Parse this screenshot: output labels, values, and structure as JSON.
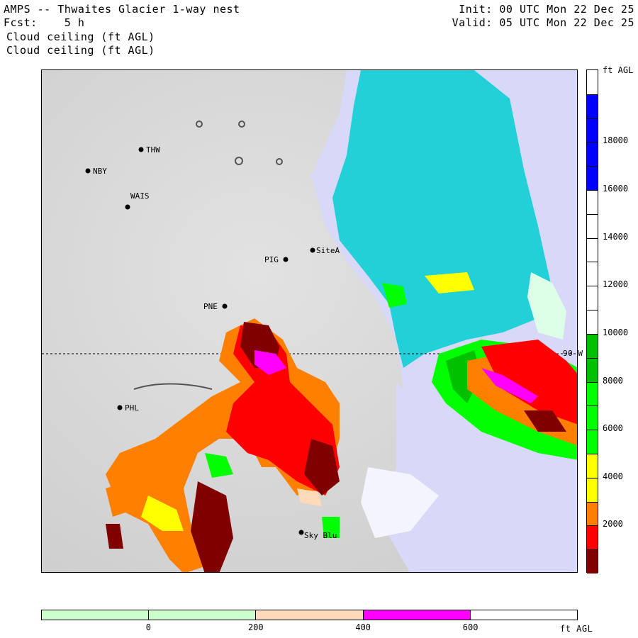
{
  "header": {
    "title": "AMPS -- Thwaites Glacier 1-way nest",
    "forecast": "Fcst:    5 h",
    "init": "Init: 00 UTC Mon 22 Dec 25",
    "valid": "Valid: 05 UTC Mon 22 Dec 25",
    "field_line1": "Cloud ceiling (ft AGL)",
    "field_line2": "Cloud ceiling (ft AGL)"
  },
  "map": {
    "stations": [
      {
        "name": "THW"
      },
      {
        "name": "NBY"
      },
      {
        "name": "WAIS"
      },
      {
        "name": "PIG"
      },
      {
        "name": "SiteA"
      },
      {
        "name": "PNE"
      },
      {
        "name": "PHL"
      },
      {
        "name": "Sky Blu"
      }
    ],
    "meridian_label": "90 W"
  },
  "colorbar": {
    "units": "ft AGL",
    "segments": [
      {
        "from": 0,
        "to": 1000,
        "color": "#800000"
      },
      {
        "from": 1000,
        "to": 2000,
        "color": "#ff0000"
      },
      {
        "from": 2000,
        "to": 3000,
        "color": "#ff8000"
      },
      {
        "from": 3000,
        "to": 4000,
        "color": "#ffff00"
      },
      {
        "from": 4000,
        "to": 5000,
        "color": "#ffff00"
      },
      {
        "from": 5000,
        "to": 6000,
        "color": "#00ff00"
      },
      {
        "from": 6000,
        "to": 7000,
        "color": "#00ff00"
      },
      {
        "from": 7000,
        "to": 8000,
        "color": "#00ff00"
      },
      {
        "from": 8000,
        "to": 9000,
        "color": "#00c000"
      },
      {
        "from": 9000,
        "to": 10000,
        "color": "#00c000"
      },
      {
        "from": 10000,
        "to": 11000,
        "color": "#ffffff"
      },
      {
        "from": 11000,
        "to": 12000,
        "color": "#ffffff"
      },
      {
        "from": 12000,
        "to": 13000,
        "color": "#ffffff"
      },
      {
        "from": 13000,
        "to": 14000,
        "color": "#ffffff"
      },
      {
        "from": 14000,
        "to": 15000,
        "color": "#ffffff"
      },
      {
        "from": 15000,
        "to": 16000,
        "color": "#ffffff"
      },
      {
        "from": 16000,
        "to": 17000,
        "color": "#0000ff"
      },
      {
        "from": 17000,
        "to": 18000,
        "color": "#0000ff"
      },
      {
        "from": 18000,
        "to": 19000,
        "color": "#0000ff"
      },
      {
        "from": 19000,
        "to": 20000,
        "color": "#0000ff"
      },
      {
        "from": 20000,
        "to": 21000,
        "color": "#ffffff"
      }
    ],
    "labels": [
      "2000",
      "4000",
      "6000",
      "8000",
      "10000",
      "12000",
      "14000",
      "16000",
      "18000"
    ]
  },
  "bottom_bar": {
    "units": "ft AGL",
    "colors": [
      "#ccffcc",
      "#ccffcc",
      "#ffdab9",
      "#ff00ff",
      "#ffffff"
    ],
    "labels": [
      "0",
      "200",
      "400",
      "600"
    ]
  }
}
